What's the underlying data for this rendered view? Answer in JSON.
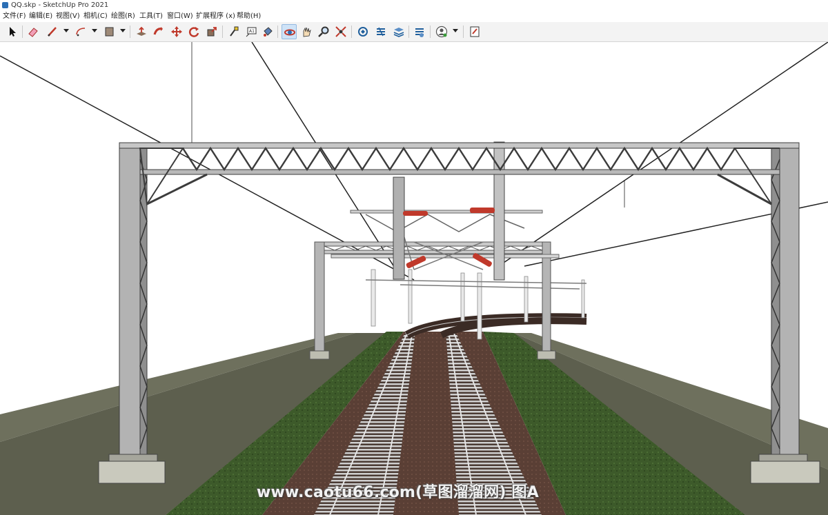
{
  "window": {
    "title": "QQ.skp - SketchUp Pro 2021"
  },
  "menu": [
    {
      "id": "file",
      "label": "文件(F)"
    },
    {
      "id": "edit",
      "label": "编辑(E)"
    },
    {
      "id": "view",
      "label": "视图(V)"
    },
    {
      "id": "camera",
      "label": "相机(C)"
    },
    {
      "id": "draw",
      "label": "绘图(R)"
    },
    {
      "id": "tools",
      "label": "工具(T)"
    },
    {
      "id": "window",
      "label": "窗口(W)"
    },
    {
      "id": "extensions",
      "label": "扩展程序 (x)"
    },
    {
      "id": "help",
      "label": "帮助(H)"
    }
  ],
  "toolbar": {
    "tools": [
      "select-icon",
      "eraser-icon",
      "line-icon",
      "arc-icon",
      "rectangle-icon",
      "push-pull-icon",
      "follow-me-icon",
      "move-icon",
      "rotate-icon",
      "scale-icon",
      "tape-measure-icon",
      "text-icon",
      "paint-bucket-icon",
      "orbit-icon",
      "pan-icon",
      "zoom-icon",
      "zoom-extents-icon",
      "3d-warehouse-icon",
      "extension-warehouse-icon",
      "layout-icon",
      "extension-manager-icon",
      "account-icon",
      "add-location-icon"
    ],
    "active": "orbit-icon"
  },
  "colors": {
    "steel": "#b8b8b8",
    "steel_dark": "#7a7a7a",
    "insulator": "#c0392b",
    "platform": "#5f6150",
    "grass": "#3f5a2c",
    "ballast": "#5b4036",
    "rail": "#d9d9d9"
  },
  "watermark": "www.caotu66.com(草图溜溜网) 图A"
}
